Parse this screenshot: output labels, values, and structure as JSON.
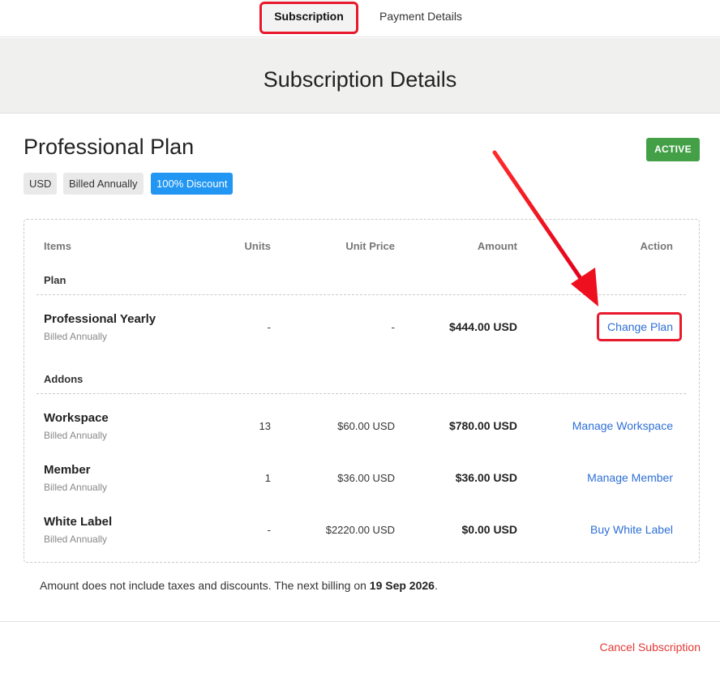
{
  "tabs": {
    "subscription": "Subscription",
    "payment": "Payment Details"
  },
  "header": {
    "title": "Subscription Details"
  },
  "plan": {
    "title": "Professional Plan",
    "status": "ACTIVE",
    "chips": {
      "currency": "USD",
      "billing": "Billed Annually",
      "discount": "100% Discount"
    }
  },
  "table": {
    "headers": {
      "items": "Items",
      "units": "Units",
      "unit_price": "Unit Price",
      "amount": "Amount",
      "action": "Action"
    },
    "plan_section": "Plan",
    "addons_section": "Addons",
    "plan_row": {
      "name": "Professional Yearly",
      "billing": "Billed Annually",
      "units": "-",
      "unit_price": "-",
      "amount": "$444.00 USD",
      "action": "Change Plan"
    },
    "addons": [
      {
        "name": "Workspace",
        "billing": "Billed Annually",
        "units": "13",
        "unit_price": "$60.00 USD",
        "amount": "$780.00 USD",
        "action": "Manage Workspace"
      },
      {
        "name": "Member",
        "billing": "Billed Annually",
        "units": "1",
        "unit_price": "$36.00 USD",
        "amount": "$36.00 USD",
        "action": "Manage Member"
      },
      {
        "name": "White Label",
        "billing": "Billed Annually",
        "units": "-",
        "unit_price": "$2220.00 USD",
        "amount": "$0.00 USD",
        "action": "Buy White Label"
      }
    ]
  },
  "footer": {
    "note_prefix": "Amount does not include taxes and discounts. The next billing on ",
    "next_billing_date": "19 Sep 2026",
    "note_suffix": ".",
    "cancel_label": "Cancel Subscription"
  },
  "colors": {
    "accent_link": "#2d6fd6",
    "active_badge": "#43a047",
    "discount_chip": "#2196f3",
    "highlight": "#e8192c",
    "cancel": "#e53935"
  }
}
